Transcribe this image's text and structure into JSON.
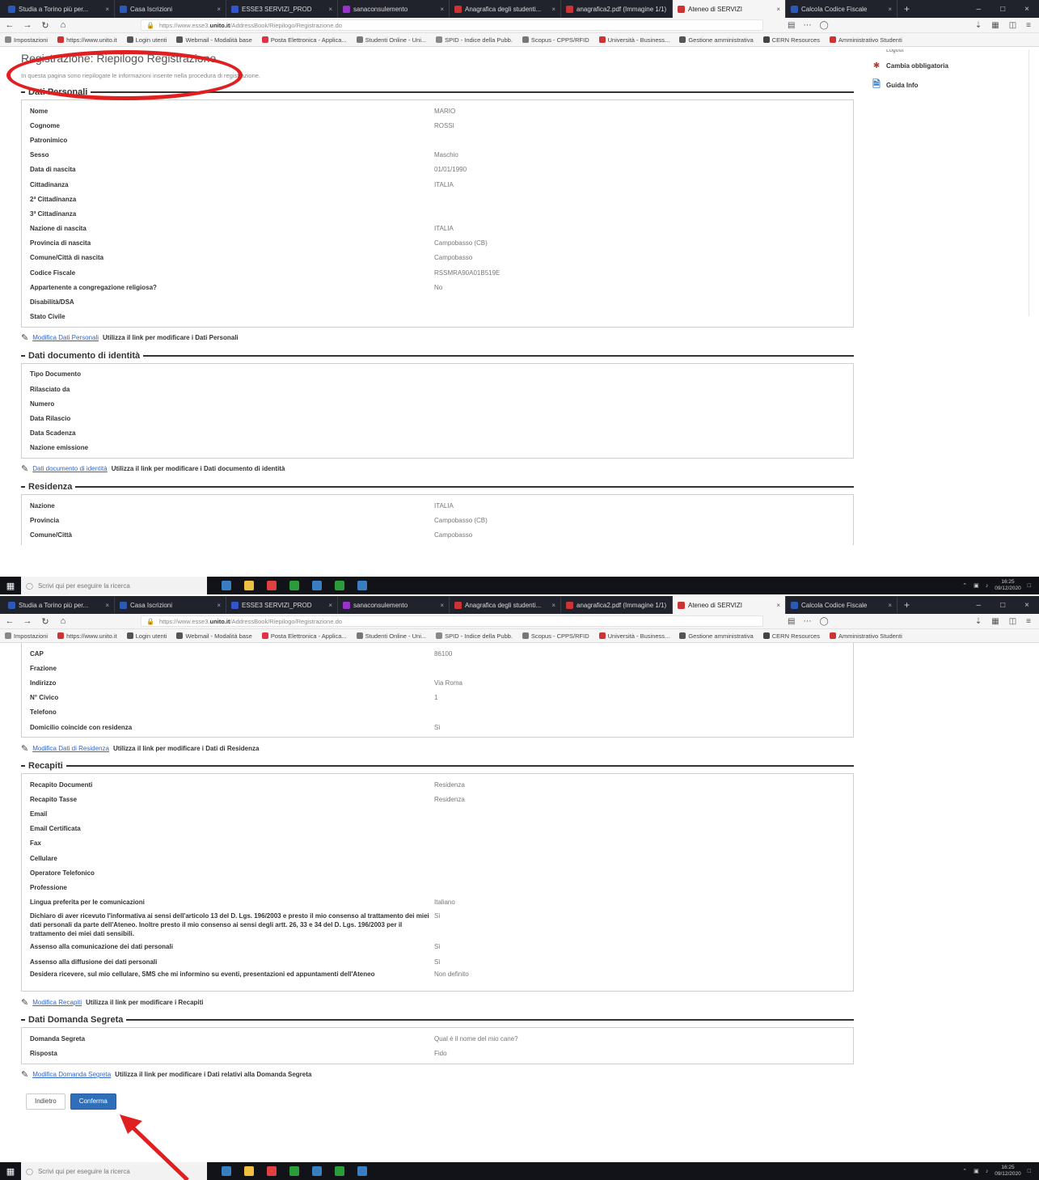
{
  "browser": {
    "tabs": [
      {
        "label": "Studia a Torino più per...",
        "color": "#2c59b3"
      },
      {
        "label": "Casa Iscrizioni",
        "color": "#2c59b3"
      },
      {
        "label": "ESSE3 SERVIZI_PROD",
        "color": "#3355cc"
      },
      {
        "label": "sanaconsulemento",
        "color": "#9933cc"
      },
      {
        "label": "Anagrafica degli studenti...",
        "color": "#cc3333"
      },
      {
        "label": "anagrafica2.pdf (Immagine 1/1)",
        "color": "#cc3333"
      },
      {
        "label": "Ateneo di SERVIZI",
        "color": "#cc3333",
        "active": true
      },
      {
        "label": "Calcola Codice Fiscale",
        "color": "#2c59b3"
      }
    ],
    "url_prefix": "https://www.esse3.",
    "url_domain": "unito.it",
    "url_path": "/AddressBook/Riepilogo/Registrazione.do",
    "bookmarks": [
      {
        "label": "Impostazioni",
        "color": "#888888"
      },
      {
        "label": "https://www.unito.it",
        "color": "#cc3333"
      },
      {
        "label": "Login utenti",
        "color": "#555555"
      },
      {
        "label": "Webmail - Modalità base",
        "color": "#555555"
      },
      {
        "label": "Posta Elettronica - Applica...",
        "color": "#dd3344"
      },
      {
        "label": "Studenti Online - Uni...",
        "color": "#777777"
      },
      {
        "label": "SPID - Indice della Pubb.",
        "color": "#888888"
      },
      {
        "label": "Scopus - CPPS/RFID",
        "color": "#777777"
      },
      {
        "label": "Università - Business...",
        "color": "#cc3333"
      },
      {
        "label": "Gestione amministrativa",
        "color": "#555555"
      },
      {
        "label": "CERN Resources",
        "color": "#444444"
      },
      {
        "label": "Amministrativo Studenti",
        "color": "#cc3333"
      }
    ]
  },
  "page": {
    "title": "Registrazione: Riepilogo Registrazione",
    "intro": "In questa pagina sono riepilogate le informazioni inserite nella procedura di registrazione.",
    "side_menu": {
      "cut_label": "Logout",
      "items": [
        {
          "label": "Cambia obbligatoria",
          "icon": "asterisk-icon"
        },
        {
          "label": "Guida Info",
          "icon": "help-document-icon"
        }
      ]
    }
  },
  "sections": {
    "personal": {
      "title": "Dati Personali",
      "rows": [
        {
          "label": "Nome",
          "value": "MARIO"
        },
        {
          "label": "Cognome",
          "value": "ROSSI"
        },
        {
          "label": "Patronimico",
          "value": ""
        },
        {
          "label": "Sesso",
          "value": "Maschio"
        },
        {
          "label": "Data di nascita",
          "value": "01/01/1990"
        },
        {
          "label": "Cittadinanza",
          "value": "ITALIA"
        },
        {
          "label": "2ª Cittadinanza",
          "value": ""
        },
        {
          "label": "3ª Cittadinanza",
          "value": ""
        },
        {
          "label": "Nazione di nascita",
          "value": "ITALIA"
        },
        {
          "label": "Provincia di nascita",
          "value": "Campobasso (CB)"
        },
        {
          "label": "Comune/Città di nascita",
          "value": "Campobasso"
        },
        {
          "label": "Codice Fiscale",
          "value": "RSSMRA90A01B519E"
        },
        {
          "label": "Appartenente a congregazione religiosa?",
          "value": "No"
        },
        {
          "label": "Disabilità/DSA",
          "value": ""
        },
        {
          "label": "Stato Civile",
          "value": ""
        }
      ],
      "edit_link": "Modifica Dati Personali",
      "edit_hint": "Utilizza il link per modificare i Dati Personali"
    },
    "identity": {
      "title": "Dati documento di identità",
      "rows": [
        {
          "label": "Tipo Documento",
          "value": ""
        },
        {
          "label": "Rilasciato da",
          "value": ""
        },
        {
          "label": "Numero",
          "value": ""
        },
        {
          "label": "Data Rilascio",
          "value": ""
        },
        {
          "label": "Data Scadenza",
          "value": ""
        },
        {
          "label": "Nazione emissione",
          "value": ""
        }
      ],
      "edit_link": "Dati documento di identità",
      "edit_hint": "Utilizza il link per modificare i Dati documento di identità"
    },
    "residence": {
      "title": "Residenza",
      "rows_top": [
        {
          "label": "Nazione",
          "value": "ITALIA"
        },
        {
          "label": "Provincia",
          "value": "Campobasso (CB)"
        },
        {
          "label": "Comune/Città",
          "value": "Campobasso"
        }
      ],
      "rows_bottom": [
        {
          "label": "CAP",
          "value": "86100"
        },
        {
          "label": "Frazione",
          "value": ""
        },
        {
          "label": "Indirizzo",
          "value": "Via Roma"
        },
        {
          "label": "N° Civico",
          "value": "1"
        },
        {
          "label": "Telefono",
          "value": ""
        },
        {
          "label": "Domicilio coincide con residenza",
          "value": "Sì"
        }
      ],
      "edit_link": "Modifica Dati di Residenza",
      "edit_hint": "Utilizza il link per modificare i Dati di Residenza"
    },
    "contacts": {
      "title": "Recapiti",
      "rows": [
        {
          "label": "Recapito Documenti",
          "value": "Residenza"
        },
        {
          "label": "Recapito Tasse",
          "value": "Residenza"
        },
        {
          "label": "Email",
          "value": ""
        },
        {
          "label": "Email Certificata",
          "value": ""
        },
        {
          "label": "Fax",
          "value": ""
        },
        {
          "label": "Cellulare",
          "value": ""
        },
        {
          "label": "Operatore Telefonico",
          "value": ""
        },
        {
          "label": "Professione",
          "value": ""
        },
        {
          "label": "Lingua preferita per le comunicazioni",
          "value": "Italiano"
        },
        {
          "label": "Dichiaro di aver ricevuto l'informativa ai sensi dell'articolo 13 del D. Lgs. 196/2003 e presto il mio consenso al trattamento dei miei dati personali da parte dell'Ateneo. Inoltre presto il mio consenso ai sensi degli artt. 26, 33 e 34 del D. Lgs. 196/2003 per il trattamento dei miei dati sensibili.",
          "value": "Sì",
          "tall": true
        },
        {
          "label": "Assenso alla comunicazione dei dati personali",
          "value": "Sì"
        },
        {
          "label": "Assenso alla diffusione dei dati personali",
          "value": "Sì"
        },
        {
          "label": "Desidera ricevere, sul mio cellulare, SMS che mi informino su eventi, presentazioni ed appuntamenti dell'Ateneo",
          "value": "Non definito",
          "two": true
        }
      ],
      "edit_link": "Modifica Recapiti",
      "edit_hint": "Utilizza il link per modificare i Recapiti"
    },
    "secret": {
      "title": "Dati Domanda Segreta",
      "rows": [
        {
          "label": "Domanda Segreta",
          "value": "Qual è il nome del mio cane?"
        },
        {
          "label": "Risposta",
          "value": "Fido"
        }
      ],
      "edit_link": "Modifica Domanda Segreta",
      "edit_hint": "Utilizza il link per modificare i Dati relativi alla Domanda Segreta"
    }
  },
  "buttons": {
    "back": "Indietro",
    "confirm": "Conferma"
  },
  "taskbar": {
    "search_placeholder": "Scrivi qui per eseguire la ricerca",
    "time": "16:25",
    "date": "09/12/2020",
    "app_colors": [
      "#3a7ec2",
      "#f0c040",
      "#e04040",
      "#2a9d3a",
      "#3a7ec2",
      "#2a9d3a",
      "#3a7ec2"
    ]
  },
  "annotations": {
    "highlight_color": "#e02020"
  }
}
